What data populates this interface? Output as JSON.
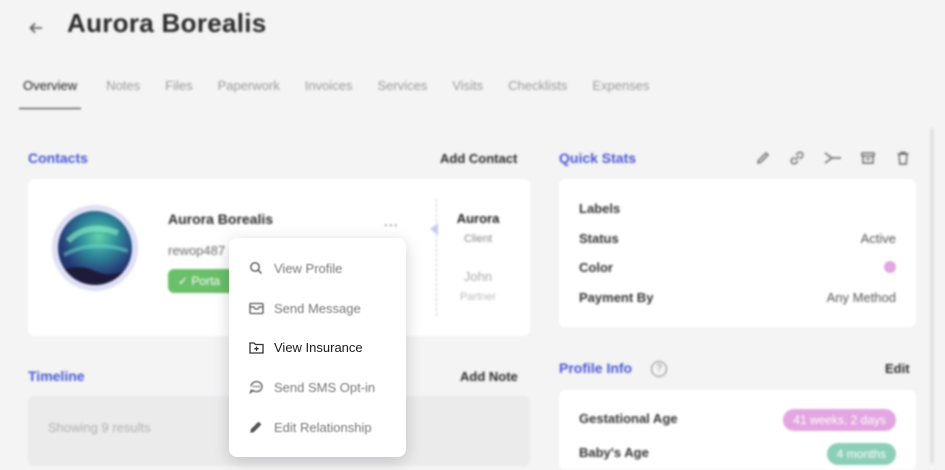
{
  "header": {
    "title": "Aurora Borealis"
  },
  "tabs": [
    "Overview",
    "Notes",
    "Files",
    "Paperwork",
    "Invoices",
    "Services",
    "Visits",
    "Checklists",
    "Expenses"
  ],
  "contacts": {
    "title": "Contacts",
    "action": "Add Contact",
    "name": "Aurora Borealis",
    "email": "rewop487",
    "portal_badge": "Porta",
    "kebab": "...",
    "relations": [
      {
        "name": "Aurora",
        "role": "Client"
      },
      {
        "name": "John",
        "role": "Partner"
      }
    ]
  },
  "timeline": {
    "title": "Timeline",
    "action": "Add Note",
    "showing": "Showing 9 results"
  },
  "quick_stats": {
    "title": "Quick Stats",
    "icons": [
      "pencil-icon",
      "link-icon",
      "merge-icon",
      "archive-icon",
      "trash-icon"
    ],
    "rows": [
      {
        "label": "Labels",
        "value": ""
      },
      {
        "label": "Status",
        "value": "Active"
      },
      {
        "label": "Color",
        "value": ""
      },
      {
        "label": "Payment By",
        "value": "Any Method"
      }
    ],
    "color_value": "#e3a6e0"
  },
  "profile_info": {
    "title": "Profile Info",
    "action": "Edit",
    "rows": [
      {
        "label": "Gestational Age",
        "value": "41 weeks, 2 days"
      },
      {
        "label": "Baby's Age",
        "value": "4 months"
      }
    ]
  },
  "context_menu": {
    "items": [
      {
        "label": "View Profile",
        "icon": "search-icon"
      },
      {
        "label": "Send Message",
        "icon": "mail-icon"
      },
      {
        "label": "View Insurance",
        "icon": "insurance-icon"
      },
      {
        "label": "Send SMS Opt-in",
        "icon": "sms-icon"
      },
      {
        "label": "Edit Relationship",
        "icon": "pencil-icon"
      }
    ]
  },
  "colors": {
    "accent": "#4b56d2",
    "portal_green": "#6abf6a",
    "pill_pink": "#e3a6e0",
    "pill_teal": "#8ccfb8"
  }
}
